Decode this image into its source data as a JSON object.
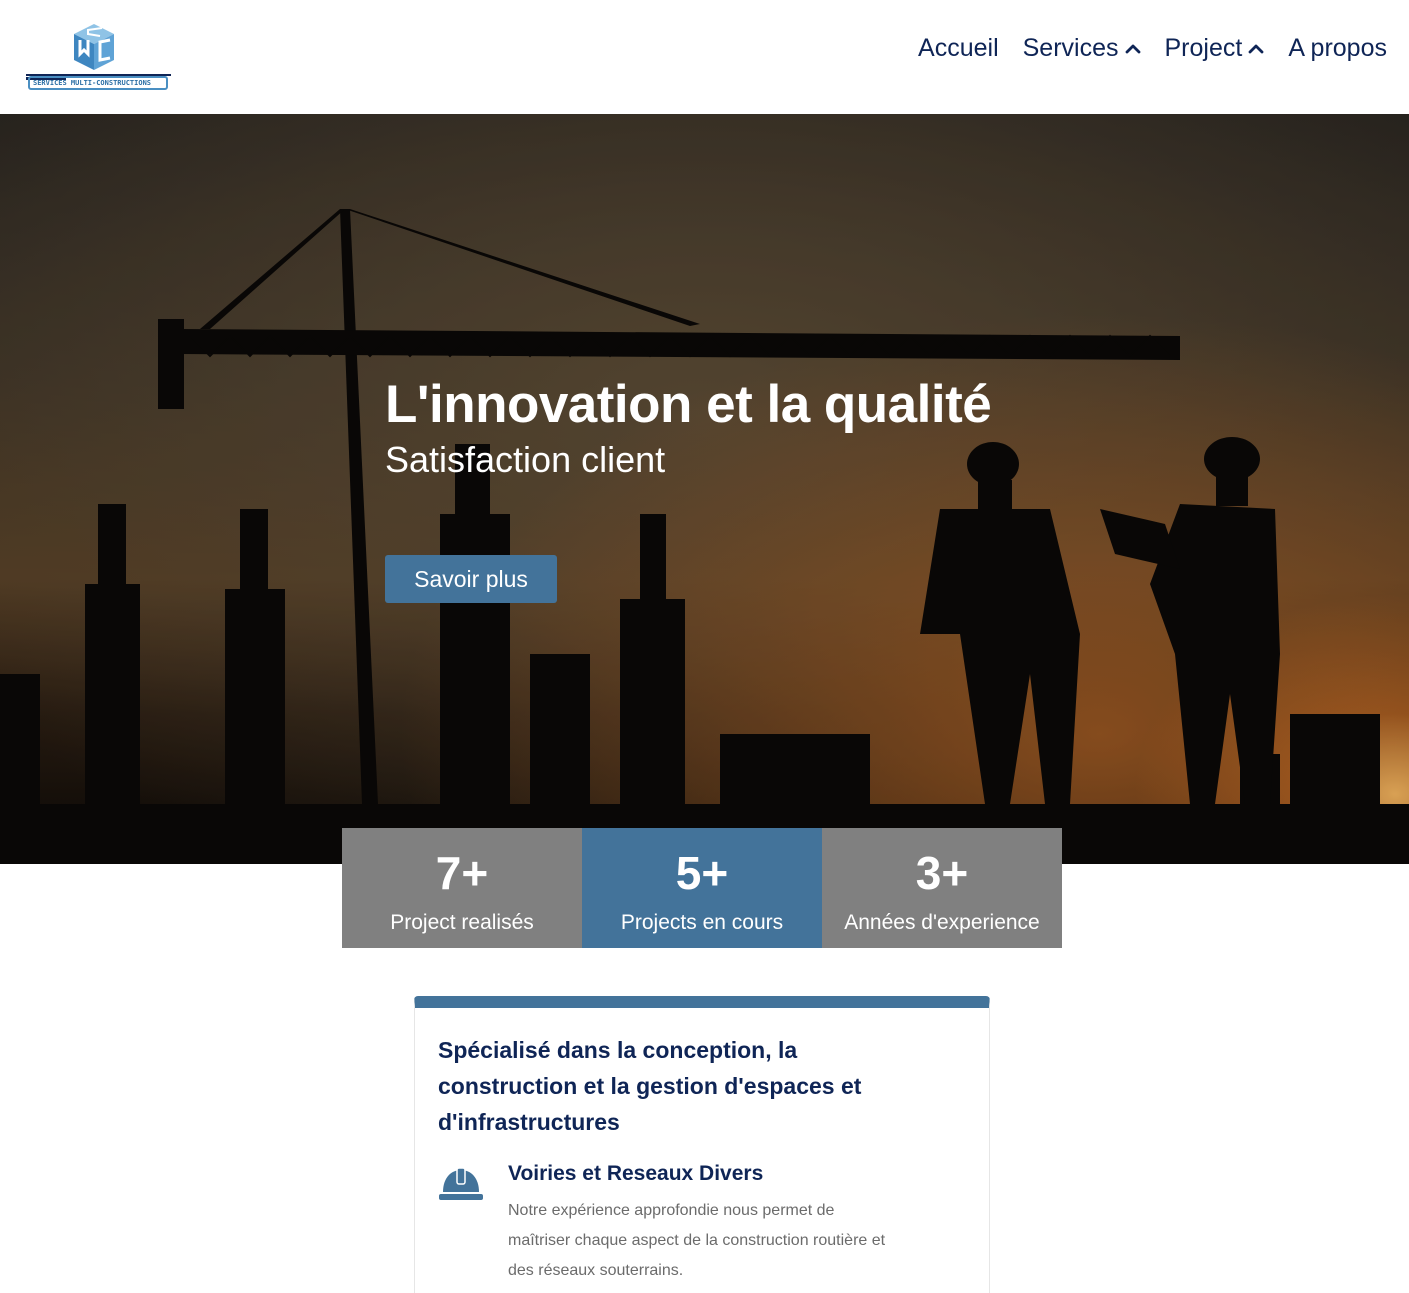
{
  "header": {
    "logo_text": "SERVICES MULTI-CONSTRUCTIONS",
    "nav": [
      {
        "label": "Accueil",
        "has_dropdown": false
      },
      {
        "label": "Services",
        "has_dropdown": true
      },
      {
        "label": "Project",
        "has_dropdown": true
      },
      {
        "label": "A propos",
        "has_dropdown": false
      }
    ]
  },
  "hero": {
    "title": "L'innovation et la qualité",
    "subtitle": "Satisfaction client",
    "button_label": "Savoir plus"
  },
  "stats": [
    {
      "value": "7+",
      "label": "Project realisés",
      "color": "#808080"
    },
    {
      "value": "5+",
      "label": "Projects en cours",
      "color": "#43739a"
    },
    {
      "value": "3+",
      "label": "Années d'experience",
      "color": "#808080"
    }
  ],
  "card": {
    "title": "Spécialisé dans la conception, la construction et la gestion d'espaces et d'infrastructures",
    "feature": {
      "icon": "hard-hat-icon",
      "title": "Voiries et Reseaux Divers",
      "text": "Notre expérience approfondie nous permet de maîtriser chaque aspect de la construction routière et des réseaux souterrains."
    }
  },
  "colors": {
    "accent": "#43739a",
    "navy": "#0f2556",
    "grey": "#808080"
  }
}
